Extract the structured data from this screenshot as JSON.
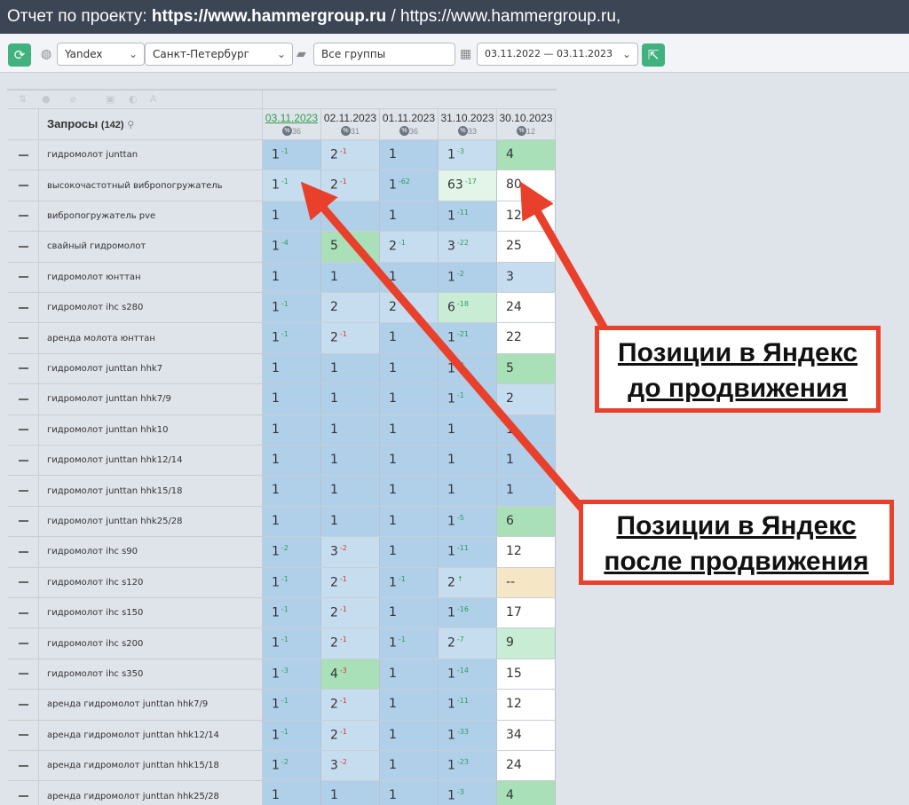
{
  "title": {
    "prefix": "Отчет по проекту: ",
    "project": "https://www.hammergroup.ru",
    "rest": " / https://www.hammergroup.ru,"
  },
  "toolbar": {
    "engine": "Yandex",
    "region": "Санкт-Петербург",
    "group": "Все группы",
    "date_range": "03.11.2022 — 03.11.2023"
  },
  "table": {
    "header_label": "Запросы",
    "header_count": "(142)",
    "columns": [
      {
        "date": "03.11.2023",
        "count": "36"
      },
      {
        "date": "02.11.2023",
        "count": "31"
      },
      {
        "date": "01.11.2023",
        "count": "36"
      },
      {
        "date": "31.10.2023",
        "count": "33"
      },
      {
        "date": "30.10.2023",
        "count": "12"
      }
    ],
    "rows": [
      {
        "kw": "гидромолот junttan",
        "cells": [
          {
            "v": "1",
            "d": "-1",
            "dir": "up",
            "c": "b"
          },
          {
            "v": "2",
            "d": "-1",
            "dir": "dn",
            "c": "l"
          },
          {
            "v": "1",
            "d": "",
            "dir": "",
            "c": "b"
          },
          {
            "v": "1",
            "d": "-3",
            "dir": "up",
            "c": "l"
          },
          {
            "v": "4",
            "d": "",
            "dir": "",
            "c": "g"
          }
        ]
      },
      {
        "kw": "высокочастотный вибропогружатель",
        "cells": [
          {
            "v": "1",
            "d": "-1",
            "dir": "up",
            "c": "l"
          },
          {
            "v": "2",
            "d": "-1",
            "dir": "dn",
            "c": "l"
          },
          {
            "v": "1",
            "d": "-62",
            "dir": "up",
            "c": "b"
          },
          {
            "v": "63",
            "d": "-17",
            "dir": "up",
            "c": "vlg"
          },
          {
            "v": "80",
            "d": "",
            "dir": "",
            "c": "w"
          }
        ]
      },
      {
        "kw": "вибропогружатель pve",
        "cells": [
          {
            "v": "1",
            "d": "",
            "dir": "",
            "c": "b"
          },
          {
            "v": "",
            "d": "",
            "dir": "",
            "c": "b"
          },
          {
            "v": "1",
            "d": "",
            "dir": "",
            "c": "b"
          },
          {
            "v": "1",
            "d": "-11",
            "dir": "up",
            "c": "b"
          },
          {
            "v": "12",
            "d": "",
            "dir": "",
            "c": "w"
          }
        ]
      },
      {
        "kw": "свайный гидромолот",
        "cells": [
          {
            "v": "1",
            "d": "-4",
            "dir": "up",
            "c": "b"
          },
          {
            "v": "5",
            "d": "",
            "dir": "",
            "c": "g"
          },
          {
            "v": "2",
            "d": "-1",
            "dir": "up",
            "c": "l"
          },
          {
            "v": "3",
            "d": "-22",
            "dir": "up",
            "c": "l"
          },
          {
            "v": "25",
            "d": "",
            "dir": "",
            "c": "w"
          }
        ]
      },
      {
        "kw": "гидромолот юнттан",
        "cells": [
          {
            "v": "1",
            "d": "",
            "dir": "",
            "c": "b"
          },
          {
            "v": "1",
            "d": "",
            "dir": "",
            "c": "b"
          },
          {
            "v": "1",
            "d": "",
            "dir": "",
            "c": "b"
          },
          {
            "v": "1",
            "d": "-2",
            "dir": "up",
            "c": "b"
          },
          {
            "v": "3",
            "d": "",
            "dir": "",
            "c": "l"
          }
        ]
      },
      {
        "kw": "гидромолот ihc s280",
        "cells": [
          {
            "v": "1",
            "d": "-1",
            "dir": "up",
            "c": "b"
          },
          {
            "v": "2",
            "d": "",
            "dir": "",
            "c": "l"
          },
          {
            "v": "2",
            "d": "",
            "dir": "",
            "c": "l"
          },
          {
            "v": "6",
            "d": "-18",
            "dir": "up",
            "c": "lg"
          },
          {
            "v": "24",
            "d": "",
            "dir": "",
            "c": "w"
          }
        ]
      },
      {
        "kw": "аренда молота юнттан",
        "cells": [
          {
            "v": "1",
            "d": "-1",
            "dir": "up",
            "c": "b"
          },
          {
            "v": "2",
            "d": "-1",
            "dir": "dn",
            "c": "l"
          },
          {
            "v": "1",
            "d": "",
            "dir": "",
            "c": "b"
          },
          {
            "v": "1",
            "d": "-21",
            "dir": "up",
            "c": "b"
          },
          {
            "v": "22",
            "d": "",
            "dir": "",
            "c": "w"
          }
        ]
      },
      {
        "kw": "гидромолот junttan hhk7",
        "cells": [
          {
            "v": "1",
            "d": "",
            "dir": "",
            "c": "b"
          },
          {
            "v": "1",
            "d": "",
            "dir": "",
            "c": "b"
          },
          {
            "v": "1",
            "d": "",
            "dir": "",
            "c": "b"
          },
          {
            "v": "1",
            "d": "-4",
            "dir": "up",
            "c": "b"
          },
          {
            "v": "5",
            "d": "",
            "dir": "",
            "c": "g"
          }
        ]
      },
      {
        "kw": "гидромолот junttan hhk7/9",
        "cells": [
          {
            "v": "1",
            "d": "",
            "dir": "",
            "c": "b"
          },
          {
            "v": "1",
            "d": "",
            "dir": "",
            "c": "b"
          },
          {
            "v": "1",
            "d": "",
            "dir": "",
            "c": "b"
          },
          {
            "v": "1",
            "d": "-1",
            "dir": "up",
            "c": "b"
          },
          {
            "v": "2",
            "d": "",
            "dir": "",
            "c": "l"
          }
        ]
      },
      {
        "kw": "гидромолот junttan hhk10",
        "cells": [
          {
            "v": "1",
            "d": "",
            "dir": "",
            "c": "b"
          },
          {
            "v": "1",
            "d": "",
            "dir": "",
            "c": "b"
          },
          {
            "v": "1",
            "d": "",
            "dir": "",
            "c": "b"
          },
          {
            "v": "1",
            "d": "",
            "dir": "",
            "c": "b"
          },
          {
            "v": "1",
            "d": "",
            "dir": "",
            "c": "b"
          }
        ]
      },
      {
        "kw": "гидромолот junttan hhk12/14",
        "cells": [
          {
            "v": "1",
            "d": "",
            "dir": "",
            "c": "b"
          },
          {
            "v": "1",
            "d": "",
            "dir": "",
            "c": "b"
          },
          {
            "v": "1",
            "d": "",
            "dir": "",
            "c": "b"
          },
          {
            "v": "1",
            "d": "",
            "dir": "",
            "c": "b"
          },
          {
            "v": "1",
            "d": "",
            "dir": "",
            "c": "b"
          }
        ]
      },
      {
        "kw": "гидромолот junttan hhk15/18",
        "cells": [
          {
            "v": "1",
            "d": "",
            "dir": "",
            "c": "b"
          },
          {
            "v": "1",
            "d": "",
            "dir": "",
            "c": "b"
          },
          {
            "v": "1",
            "d": "",
            "dir": "",
            "c": "b"
          },
          {
            "v": "1",
            "d": "",
            "dir": "",
            "c": "b"
          },
          {
            "v": "1",
            "d": "",
            "dir": "",
            "c": "b"
          }
        ]
      },
      {
        "kw": "гидромолот junttan hhk25/28",
        "cells": [
          {
            "v": "1",
            "d": "",
            "dir": "",
            "c": "b"
          },
          {
            "v": "1",
            "d": "",
            "dir": "",
            "c": "b"
          },
          {
            "v": "1",
            "d": "",
            "dir": "",
            "c": "b"
          },
          {
            "v": "1",
            "d": "-5",
            "dir": "up",
            "c": "b"
          },
          {
            "v": "6",
            "d": "",
            "dir": "",
            "c": "g"
          }
        ]
      },
      {
        "kw": "гидромолот ihc s90",
        "cells": [
          {
            "v": "1",
            "d": "-2",
            "dir": "up",
            "c": "b"
          },
          {
            "v": "3",
            "d": "-2",
            "dir": "dn",
            "c": "l"
          },
          {
            "v": "1",
            "d": "",
            "dir": "",
            "c": "b"
          },
          {
            "v": "1",
            "d": "-11",
            "dir": "up",
            "c": "b"
          },
          {
            "v": "12",
            "d": "",
            "dir": "",
            "c": "w"
          }
        ]
      },
      {
        "kw": "гидромолот ihc s120",
        "cells": [
          {
            "v": "1",
            "d": "-1",
            "dir": "up",
            "c": "b"
          },
          {
            "v": "2",
            "d": "-1",
            "dir": "dn",
            "c": "l"
          },
          {
            "v": "1",
            "d": "-1",
            "dir": "up",
            "c": "b"
          },
          {
            "v": "2",
            "d": "↑",
            "dir": "up",
            "c": "l"
          },
          {
            "v": "--",
            "d": "",
            "dir": "",
            "c": "y"
          }
        ]
      },
      {
        "kw": "гидромолот ihc s150",
        "cells": [
          {
            "v": "1",
            "d": "-1",
            "dir": "up",
            "c": "b"
          },
          {
            "v": "2",
            "d": "-1",
            "dir": "dn",
            "c": "l"
          },
          {
            "v": "1",
            "d": "",
            "dir": "",
            "c": "b"
          },
          {
            "v": "1",
            "d": "-16",
            "dir": "up",
            "c": "b"
          },
          {
            "v": "17",
            "d": "",
            "dir": "",
            "c": "w"
          }
        ]
      },
      {
        "kw": "гидромолот ihc s200",
        "cells": [
          {
            "v": "1",
            "d": "-1",
            "dir": "up",
            "c": "b"
          },
          {
            "v": "2",
            "d": "-1",
            "dir": "dn",
            "c": "l"
          },
          {
            "v": "1",
            "d": "-1",
            "dir": "up",
            "c": "b"
          },
          {
            "v": "2",
            "d": "-7",
            "dir": "up",
            "c": "l"
          },
          {
            "v": "9",
            "d": "",
            "dir": "",
            "c": "lg"
          }
        ]
      },
      {
        "kw": "гидромолот ihc s350",
        "cells": [
          {
            "v": "1",
            "d": "-3",
            "dir": "up",
            "c": "b"
          },
          {
            "v": "4",
            "d": "-3",
            "dir": "dn",
            "c": "g"
          },
          {
            "v": "1",
            "d": "",
            "dir": "",
            "c": "b"
          },
          {
            "v": "1",
            "d": "-14",
            "dir": "up",
            "c": "b"
          },
          {
            "v": "15",
            "d": "",
            "dir": "",
            "c": "w"
          }
        ]
      },
      {
        "kw": "аренда гидромолот junttan hhk7/9",
        "cells": [
          {
            "v": "1",
            "d": "-1",
            "dir": "up",
            "c": "b"
          },
          {
            "v": "2",
            "d": "-1",
            "dir": "dn",
            "c": "l"
          },
          {
            "v": "1",
            "d": "",
            "dir": "",
            "c": "b"
          },
          {
            "v": "1",
            "d": "-11",
            "dir": "up",
            "c": "b"
          },
          {
            "v": "12",
            "d": "",
            "dir": "",
            "c": "w"
          }
        ]
      },
      {
        "kw": "аренда гидромолот junttan hhk12/14",
        "cells": [
          {
            "v": "1",
            "d": "-1",
            "dir": "up",
            "c": "b"
          },
          {
            "v": "2",
            "d": "-1",
            "dir": "dn",
            "c": "l"
          },
          {
            "v": "1",
            "d": "",
            "dir": "",
            "c": "b"
          },
          {
            "v": "1",
            "d": "-33",
            "dir": "up",
            "c": "b"
          },
          {
            "v": "34",
            "d": "",
            "dir": "",
            "c": "w"
          }
        ]
      },
      {
        "kw": "аренда гидромолот junttan hhk15/18",
        "cells": [
          {
            "v": "1",
            "d": "-2",
            "dir": "up",
            "c": "b"
          },
          {
            "v": "3",
            "d": "-2",
            "dir": "dn",
            "c": "l"
          },
          {
            "v": "1",
            "d": "",
            "dir": "",
            "c": "b"
          },
          {
            "v": "1",
            "d": "-23",
            "dir": "up",
            "c": "b"
          },
          {
            "v": "24",
            "d": "",
            "dir": "",
            "c": "w"
          }
        ]
      },
      {
        "kw": "аренда гидромолот junttan hhk25/28",
        "cells": [
          {
            "v": "1",
            "d": "",
            "dir": "",
            "c": "b"
          },
          {
            "v": "1",
            "d": "",
            "dir": "",
            "c": "b"
          },
          {
            "v": "1",
            "d": "",
            "dir": "",
            "c": "b"
          },
          {
            "v": "1",
            "d": "-3",
            "dir": "up",
            "c": "b"
          },
          {
            "v": "4",
            "d": "",
            "dir": "",
            "c": "g"
          }
        ]
      }
    ]
  },
  "callouts": {
    "before": [
      "Позиции в Яндекс",
      "до продвижения"
    ],
    "after": [
      "Позиции в Яндекс",
      "после продвижения"
    ]
  },
  "colors": {
    "arrow": "#e8402b",
    "header": "#3b4554",
    "accent_green": "#3fb27f"
  },
  "icons": [
    "refresh-icon",
    "globe-icon",
    "folder-icon",
    "calendar-icon",
    "export-icon",
    "search-icon",
    "percent-icon"
  ]
}
